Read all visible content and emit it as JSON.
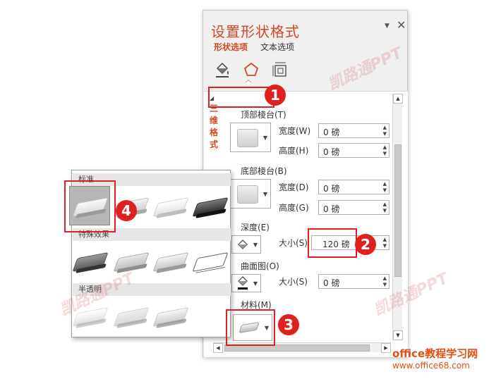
{
  "pane": {
    "title": "设置形状格式",
    "tabs": [
      "形状选项",
      "文本选项"
    ],
    "menu_glyph": "▼",
    "close_glyph": "✕"
  },
  "section": {
    "arrow": "◢",
    "title": "三维格式"
  },
  "bevel_top": {
    "label": "顶部棱台(T)",
    "width_label": "宽度(W)",
    "width_value": "0 磅",
    "height_label": "高度(H)",
    "height_value": "0 磅"
  },
  "bevel_bottom": {
    "label": "底部棱台(B)",
    "width_label": "宽度(D)",
    "width_value": "0 磅",
    "height_label": "高度(G)",
    "height_value": "0 磅"
  },
  "depth": {
    "label": "深度(E)",
    "size_label": "大小(S)",
    "size_value": "120 磅"
  },
  "contour": {
    "label": "曲面图(O)",
    "size_label": "大小(S)",
    "size_value": "0 磅"
  },
  "material": {
    "label": "材料(M)"
  },
  "gallery": {
    "groups": [
      "标准",
      "特殊效果",
      "半透明"
    ]
  },
  "badges": [
    "1",
    "2",
    "3",
    "4"
  ],
  "watermark": "凯路通PPT",
  "site": {
    "name": "office教程学习网",
    "url": "www.office68.com"
  },
  "colors": {
    "accent": "#d24726",
    "callout": "#e0201f"
  }
}
